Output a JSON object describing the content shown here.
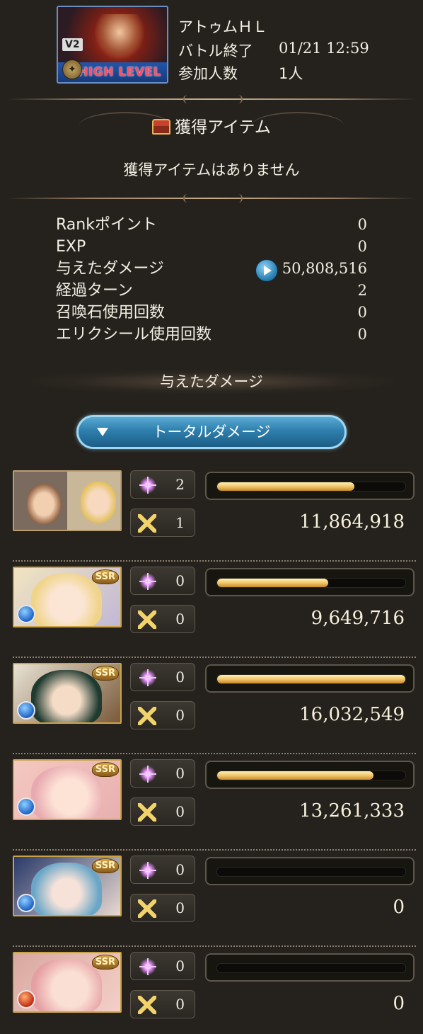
{
  "quest": {
    "badge": "V2",
    "difficulty": "HIGH LEVEL",
    "name": "アトゥムＨＬ",
    "battle_end_label": "バトル終了",
    "battle_end_time": "01/21 12:59",
    "participants_label": "参加人数",
    "participants": "1人"
  },
  "items": {
    "title": "獲得アイテム",
    "empty_message": "獲得アイテムはありません"
  },
  "stats": [
    {
      "label": "Rankポイント",
      "value": "0"
    },
    {
      "label": "EXP",
      "value": "0"
    },
    {
      "label": "与えたダメージ",
      "value": "50,808,516"
    },
    {
      "label": "経過ターン",
      "value": "2"
    },
    {
      "label": "召喚石使用回数",
      "value": "0"
    },
    {
      "label": "エリクシール使用回数",
      "value": "0"
    }
  ],
  "damage_section": {
    "title": "与えたダメージ",
    "total_button": "トータルダメージ"
  },
  "characters": [
    {
      "portrait": "main-character-pair",
      "rarity": "",
      "element": "",
      "skills": "2",
      "ougi": "1",
      "damage": "11,864,918",
      "bar_fraction": 0.73
    },
    {
      "portrait": "character-blonde",
      "rarity": "SSR",
      "element": "water",
      "skills": "0",
      "ougi": "0",
      "damage": "9,649,716",
      "bar_fraction": 0.59
    },
    {
      "portrait": "character-green-hair",
      "rarity": "SSR",
      "element": "water",
      "skills": "0",
      "ougi": "0",
      "damage": "16,032,549",
      "bar_fraction": 1.0
    },
    {
      "portrait": "character-pink",
      "rarity": "SSR",
      "element": "water",
      "skills": "0",
      "ougi": "0",
      "damage": "13,261,333",
      "bar_fraction": 0.83
    },
    {
      "portrait": "character-blue-hair",
      "rarity": "SSR",
      "element": "water",
      "skills": "0",
      "ougi": "0",
      "damage": "0",
      "bar_fraction": 0
    },
    {
      "portrait": "character-pink-hair",
      "rarity": "SSR",
      "element": "fire",
      "skills": "0",
      "ougi": "0",
      "damage": "0",
      "bar_fraction": 0
    }
  ]
}
